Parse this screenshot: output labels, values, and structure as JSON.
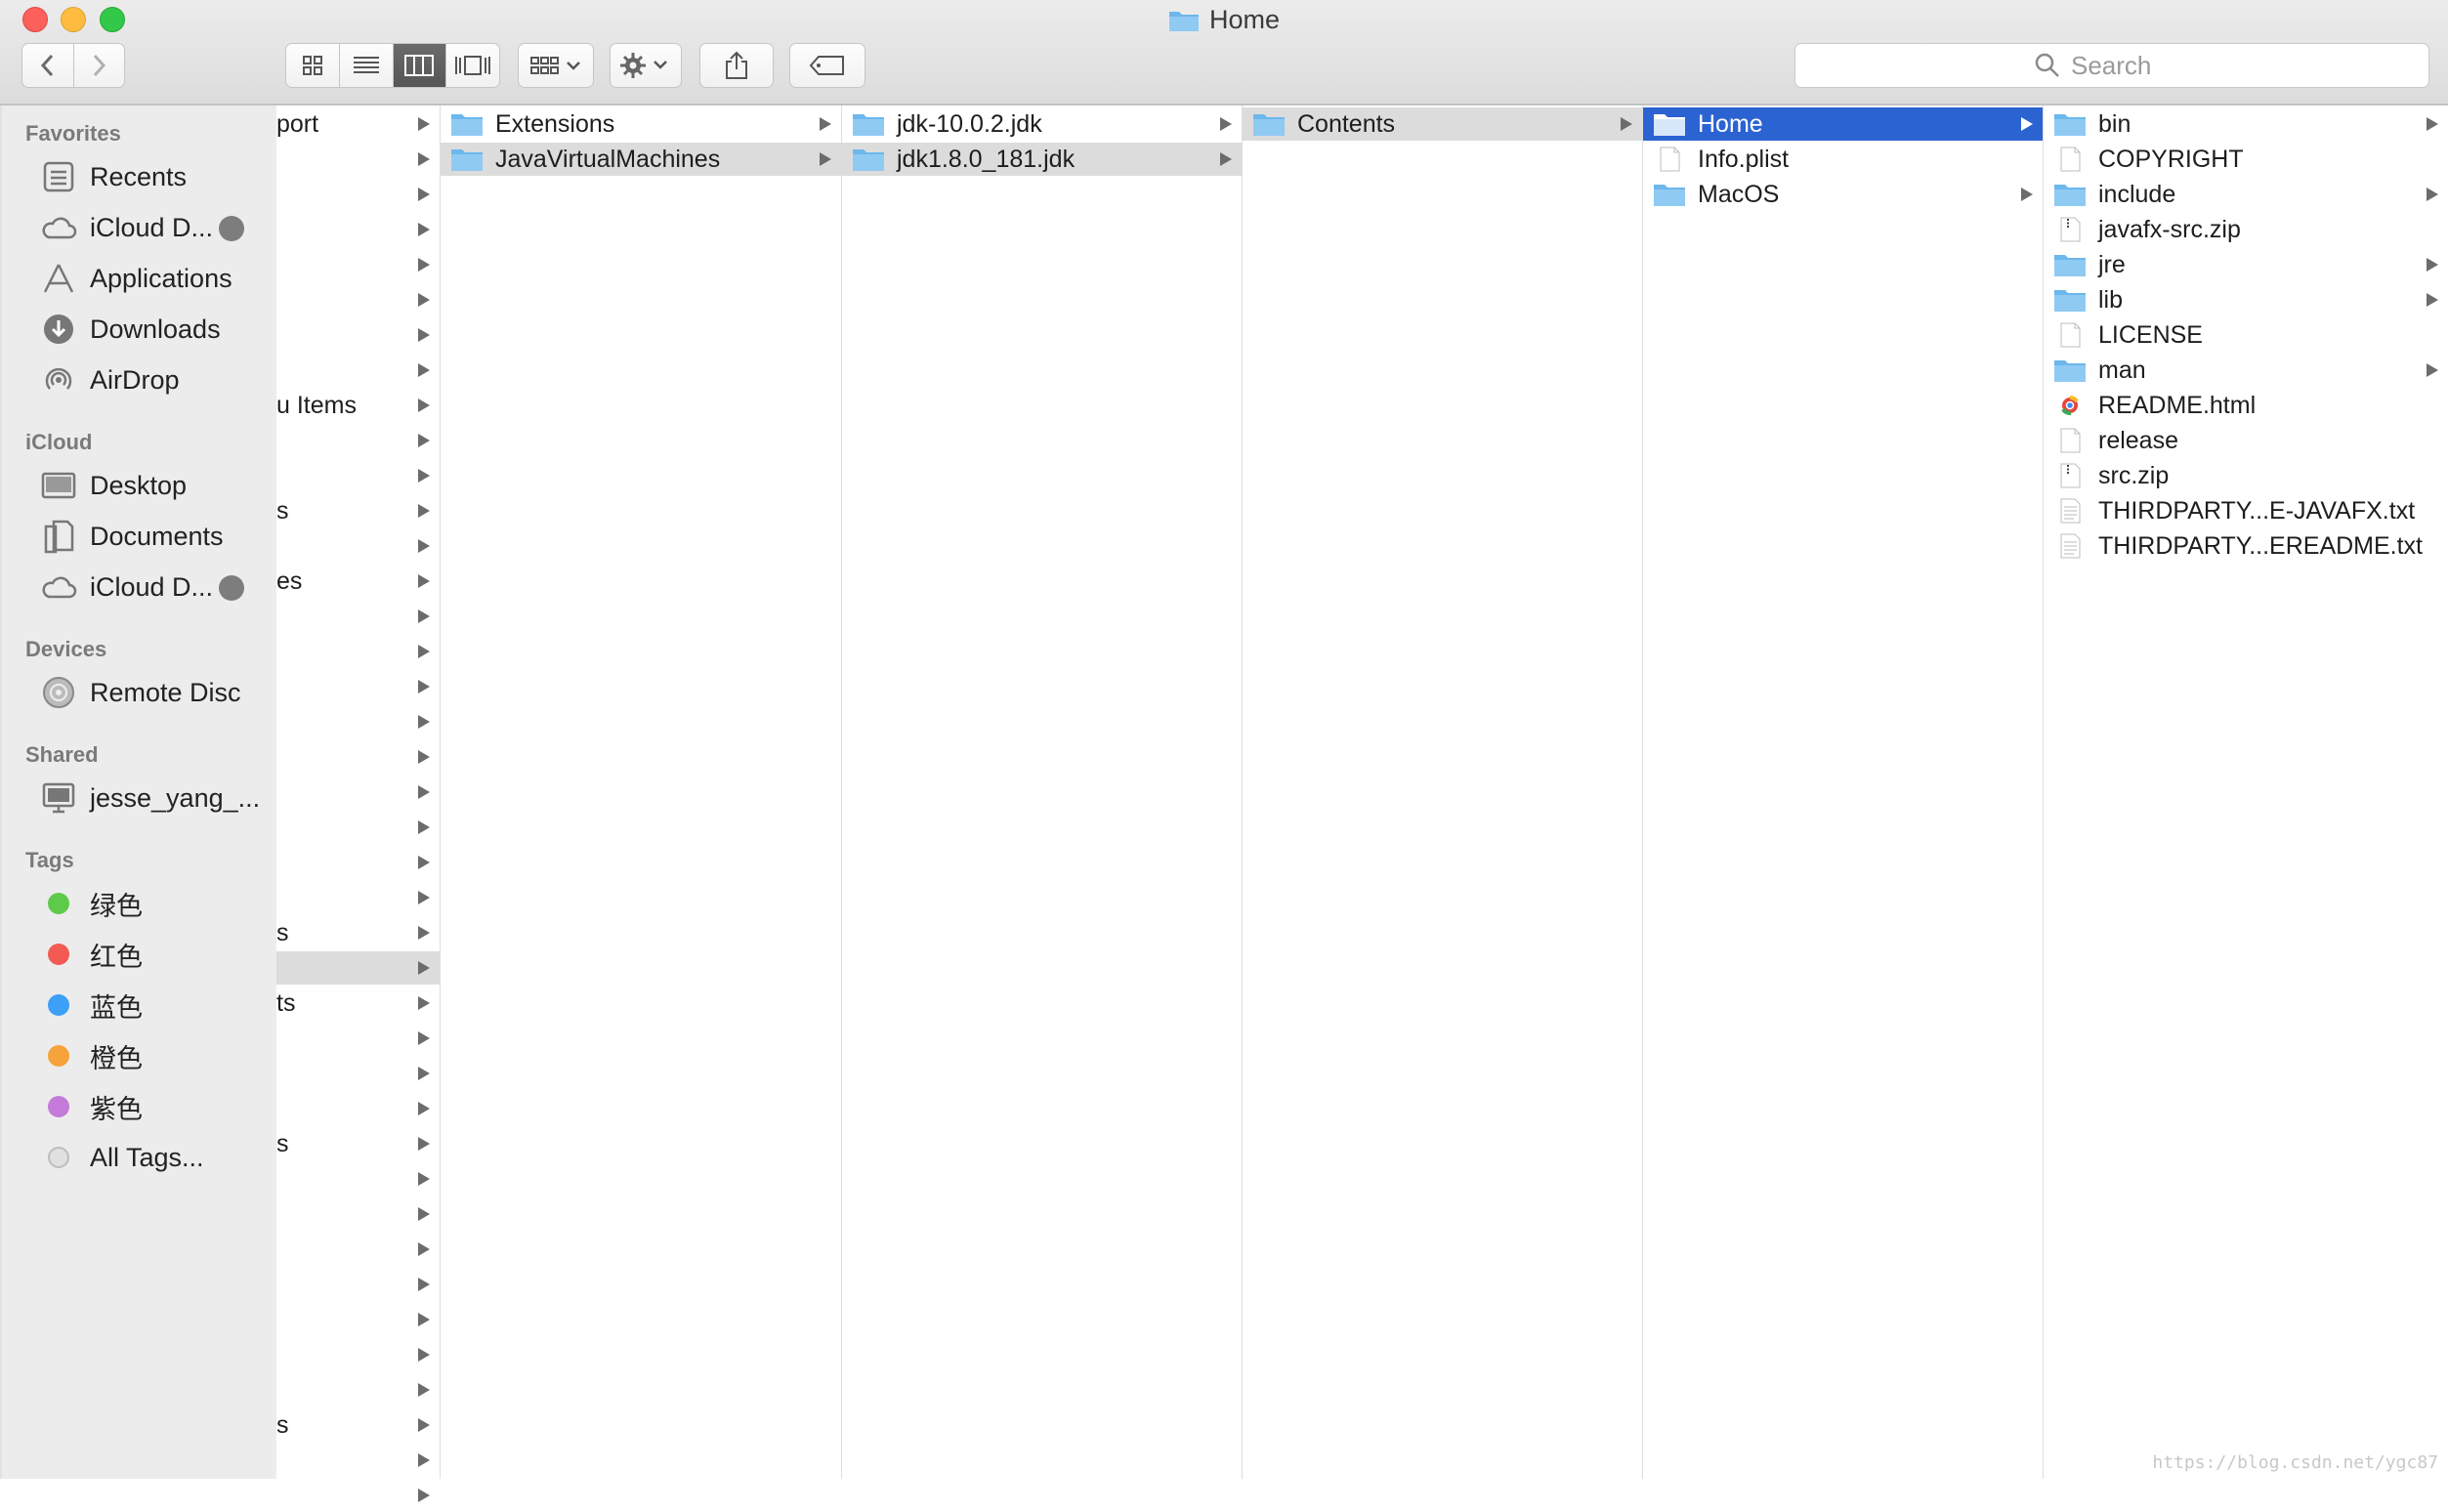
{
  "window": {
    "title": "Home"
  },
  "toolbar": {
    "back_icon": "chevron-left-icon",
    "forward_icon": "chevron-right-icon",
    "view_modes": [
      "icon-view",
      "list-view",
      "column-view",
      "cover-flow-view"
    ],
    "active_view": "column-view",
    "search_placeholder": "Search"
  },
  "sidebar": {
    "sections": [
      {
        "title": "Favorites",
        "items": [
          {
            "label": "Recents",
            "icon": "recents-icon"
          },
          {
            "label": "iCloud D...",
            "icon": "icloud-icon",
            "progress": true
          },
          {
            "label": "Applications",
            "icon": "applications-icon"
          },
          {
            "label": "Downloads",
            "icon": "downloads-icon"
          },
          {
            "label": "AirDrop",
            "icon": "airdrop-icon"
          }
        ]
      },
      {
        "title": "iCloud",
        "items": [
          {
            "label": "Desktop",
            "icon": "desktop-icon"
          },
          {
            "label": "Documents",
            "icon": "documents-icon"
          },
          {
            "label": "iCloud D...",
            "icon": "icloud-icon",
            "progress": true
          }
        ]
      },
      {
        "title": "Devices",
        "items": [
          {
            "label": "Remote Disc",
            "icon": "disc-icon"
          }
        ]
      },
      {
        "title": "Shared",
        "items": [
          {
            "label": "jesse_yang_...",
            "icon": "computer-icon"
          }
        ]
      },
      {
        "title": "Tags",
        "items": [
          {
            "label": "绿色",
            "color": "#5fc94a"
          },
          {
            "label": "红色",
            "color": "#f25a53"
          },
          {
            "label": "蓝色",
            "color": "#3d9ff5"
          },
          {
            "label": "橙色",
            "color": "#f5a33a"
          },
          {
            "label": "紫色",
            "color": "#c37ad9"
          },
          {
            "label": "All Tags...",
            "color": "#e0e0e0"
          }
        ]
      }
    ]
  },
  "columns": {
    "col0": {
      "fragments": [
        "port",
        "",
        "",
        "",
        "",
        "",
        "",
        "",
        "u Items",
        "",
        "",
        "s",
        "",
        "es",
        "",
        "",
        "",
        "",
        "",
        "",
        "",
        "",
        "",
        "s",
        "",
        "ts",
        "",
        "",
        "",
        "s",
        "",
        "",
        "",
        "",
        "",
        "",
        "",
        "s",
        "",
        ""
      ],
      "selected_index": 24
    },
    "col1": [
      {
        "name": "Extensions",
        "type": "folder",
        "arrow": true
      },
      {
        "name": "JavaVirtualMachines",
        "type": "folder",
        "arrow": true,
        "selected": "gray"
      }
    ],
    "col2": [
      {
        "name": "jdk-10.0.2.jdk",
        "type": "folder",
        "arrow": true
      },
      {
        "name": "jdk1.8.0_181.jdk",
        "type": "folder",
        "arrow": true,
        "selected": "gray"
      }
    ],
    "col3": [
      {
        "name": "Contents",
        "type": "folder",
        "arrow": true,
        "selected": "gray"
      }
    ],
    "col4": [
      {
        "name": "Home",
        "type": "folder",
        "arrow": true,
        "selected": "blue"
      },
      {
        "name": "Info.plist",
        "type": "file",
        "arrow": false
      },
      {
        "name": "MacOS",
        "type": "folder",
        "arrow": true
      }
    ],
    "col5": [
      {
        "name": "bin",
        "type": "folder",
        "arrow": true
      },
      {
        "name": "COPYRIGHT",
        "type": "file",
        "arrow": false
      },
      {
        "name": "include",
        "type": "folder",
        "arrow": true
      },
      {
        "name": "javafx-src.zip",
        "type": "zip",
        "arrow": false
      },
      {
        "name": "jre",
        "type": "folder",
        "arrow": true
      },
      {
        "name": "lib",
        "type": "folder",
        "arrow": true
      },
      {
        "name": "LICENSE",
        "type": "file",
        "arrow": false
      },
      {
        "name": "man",
        "type": "folder",
        "arrow": true
      },
      {
        "name": "README.html",
        "type": "html",
        "arrow": false
      },
      {
        "name": "release",
        "type": "file",
        "arrow": false
      },
      {
        "name": "src.zip",
        "type": "zip",
        "arrow": false
      },
      {
        "name": "THIRDPARTY...E-JAVAFX.txt",
        "type": "text",
        "arrow": false
      },
      {
        "name": "THIRDPARTY...EREADME.txt",
        "type": "text",
        "arrow": false
      }
    ]
  },
  "watermark": "https://blog.csdn.net/ygc87"
}
